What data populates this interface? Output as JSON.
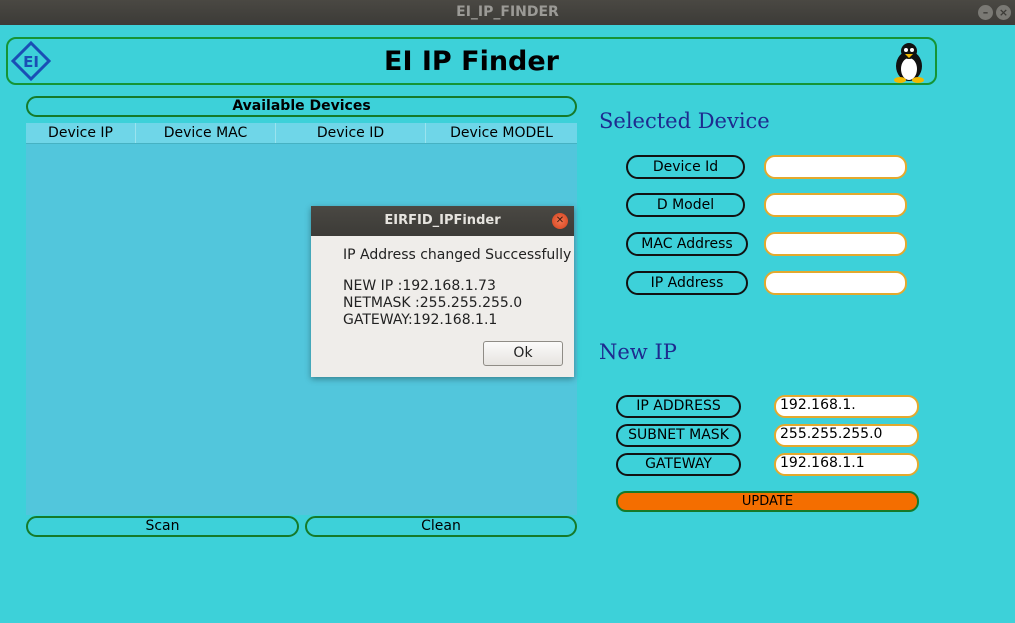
{
  "window": {
    "title": "EI_IP_FINDER"
  },
  "header": {
    "title": "EI IP Finder",
    "logo_icon": "ei-logo-icon",
    "mascot_icon": "tux-penguin-icon"
  },
  "devices": {
    "title": "Available Devices",
    "columns": [
      "Device IP",
      "Device MAC",
      "Device ID",
      "Device MODEL"
    ],
    "rows": []
  },
  "buttons": {
    "scan": "Scan",
    "clean": "Clean",
    "update": "UPDATE"
  },
  "selected_device": {
    "title": "Selected Device",
    "fields": [
      {
        "label": "Device Id",
        "value": ""
      },
      {
        "label": "D Model",
        "value": ""
      },
      {
        "label": "MAC Address",
        "value": ""
      },
      {
        "label": "IP Address",
        "value": ""
      }
    ]
  },
  "new_ip": {
    "title": "New IP",
    "fields": [
      {
        "label": "IP ADDRESS",
        "value": "192.168.1."
      },
      {
        "label": "SUBNET MASK",
        "value": "255.255.255.0"
      },
      {
        "label": "GATEWAY",
        "value": "192.168.1.1"
      }
    ]
  },
  "dialog": {
    "title": "EIRFID_IPFinder",
    "message": "IP Address changed Successfully",
    "lines": [
      "NEW IP :192.168.1.73",
      "NETMASK :255.255.255.0",
      "GATEWAY:192.168.1.1"
    ],
    "ok_label": "Ok"
  },
  "colors": {
    "background": "#3dd1d9",
    "border": "#159436",
    "accent": "#f46e00",
    "section_title": "#1e2b8f"
  }
}
